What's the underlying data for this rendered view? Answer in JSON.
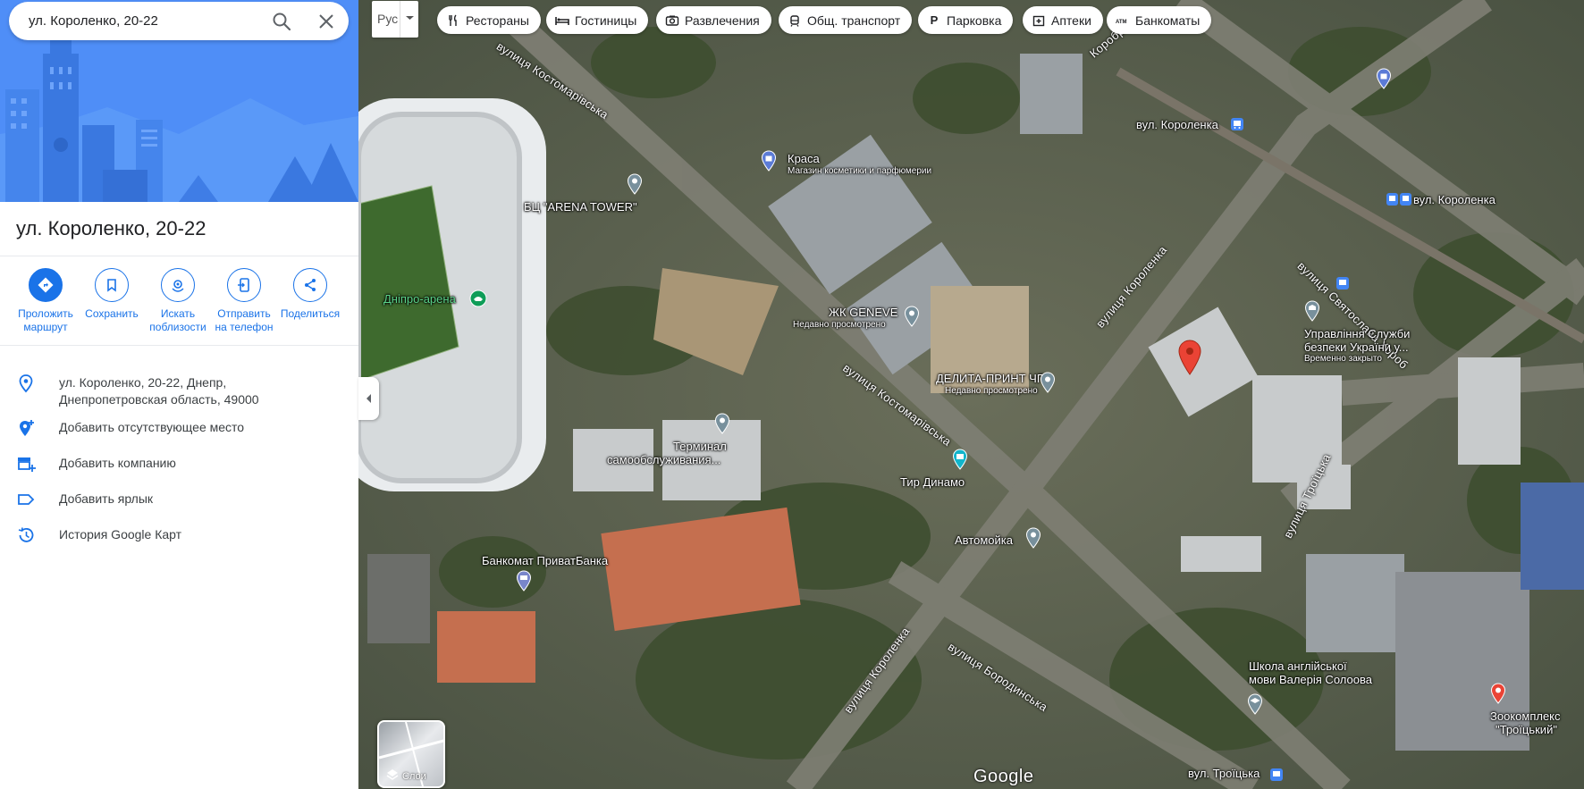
{
  "search": {
    "value": "ул. Короленко, 20-22"
  },
  "place": {
    "title": "ул. Короленко, 20-22"
  },
  "actions": [
    {
      "label": "Проложить маршрут",
      "icon": "directions-icon"
    },
    {
      "label": "Сохранить",
      "icon": "bookmark-icon"
    },
    {
      "label": "Искать поблизости",
      "icon": "nearby-icon"
    },
    {
      "label": "Отправить на телефон",
      "icon": "send-to-phone-icon"
    },
    {
      "label": "Поделиться",
      "icon": "share-icon"
    }
  ],
  "info": {
    "address_line1": "ул. Короленко, 20-22, Днепр,",
    "address_line2": "Днепропетровская область, 49000",
    "add_missing_place": "Добавить отсутствующее место",
    "add_business": "Добавить компанию",
    "add_label": "Добавить ярлык",
    "history": "История Google Карт"
  },
  "map": {
    "lang_button": "Рус",
    "chips": [
      "Рестораны",
      "Гостиницы",
      "Развлечения",
      "Общ. транспорт",
      "Парковка",
      "Аптеки",
      "Банкоматы"
    ],
    "labels": {
      "arena_tower": "БЦ \"ARENA TOWER\"",
      "dnipro_arena": "Дніпро-арена",
      "krasa": "Краса",
      "krasa_sub": "Магазин косметики и парфюмерии",
      "geneve": "ЖК GENEVE",
      "geneve_sub": "Недавно просмотрено",
      "delita": "ДЕЛИТА-ПРИНТ ЧП",
      "delita_sub": "Недавно просмотрено",
      "terminal_1": "Терминал",
      "terminal_2": "самообслуживания...",
      "tir": "Тир Динамо",
      "automoika": "Автомойка",
      "privat": "Банкомат ПриватБанка",
      "upravlinnia_1": "Управління Служби",
      "upravlinnia_2": "безпеки України у...",
      "upravlinnia_sub": "Временно закрыто",
      "school_1": "Школа англійської",
      "school_2": "мови Валерія Солоова",
      "zoo_1": "Зоокомплекс",
      "zoo_2": "\"Троїцький\"",
      "stop_korolenka_1": "вул. Короленка",
      "stop_korolenka_2": "вул. Короленка",
      "stop_troitska": "вул. Троїцька"
    },
    "streets": {
      "kostomarivska_1": "вулиця Костомарівська",
      "kostomarivska_2": "вулиця Костомарівська",
      "korolenka_1": "вулиця Короленка",
      "korolenka_2": "вулиця Короленка",
      "borodinska": "вулиця Бородинська",
      "troitska": "вулиця Троїцька",
      "sviatoslava": "вулиця Святослава Хороб",
      "korobroho": "Короброго"
    },
    "layers_label": "Слои",
    "logo": "Google"
  }
}
